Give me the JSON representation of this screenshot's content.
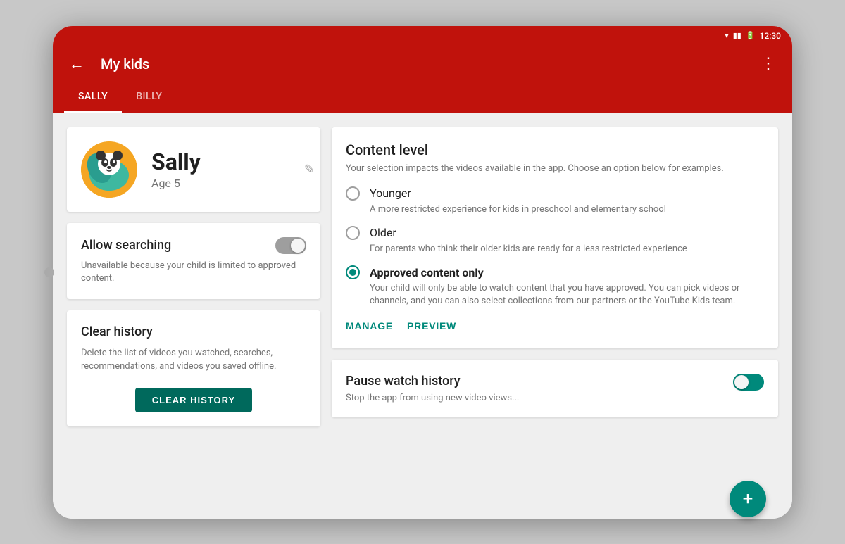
{
  "statusBar": {
    "time": "12:30",
    "wifiIcon": "▼",
    "batteryIcon": "▮",
    "signalIcon": "▮"
  },
  "toolbar": {
    "backLabel": "←",
    "title": "My kids",
    "moreIcon": "⋮"
  },
  "tabs": [
    {
      "label": "Sally",
      "active": true
    },
    {
      "label": "Billy",
      "active": false
    }
  ],
  "profile": {
    "name": "Sally",
    "age": "Age 5",
    "editIcon": "✎"
  },
  "allowSearching": {
    "title": "Allow searching",
    "description": "Unavailable because your child is limited to approved content.",
    "enabled": false
  },
  "clearHistory": {
    "title": "Clear history",
    "description": "Delete the list of videos you watched, searches, recommendations, and videos you saved offline.",
    "buttonLabel": "CLEAR HISTORY"
  },
  "contentLevel": {
    "title": "Content level",
    "description": "Your selection impacts the videos available in the app. Choose an option below for examples.",
    "options": [
      {
        "label": "Younger",
        "description": "A more restricted experience for kids in preschool and elementary school",
        "selected": false
      },
      {
        "label": "Older",
        "description": "For parents who think their older kids are ready for a less restricted experience",
        "selected": false
      },
      {
        "label": "Approved content only",
        "description": "Your child will only be able to watch content that you have approved. You can pick videos or channels, and you can also select collections from our partners or the YouTube Kids team.",
        "selected": true
      }
    ],
    "manageLabel": "MANAGE",
    "previewLabel": "PREVIEW"
  },
  "pauseWatchHistory": {
    "title": "Pause watch history",
    "description": "Stop the app from using new video views...",
    "enabled": true
  },
  "fab": {
    "label": "+"
  }
}
